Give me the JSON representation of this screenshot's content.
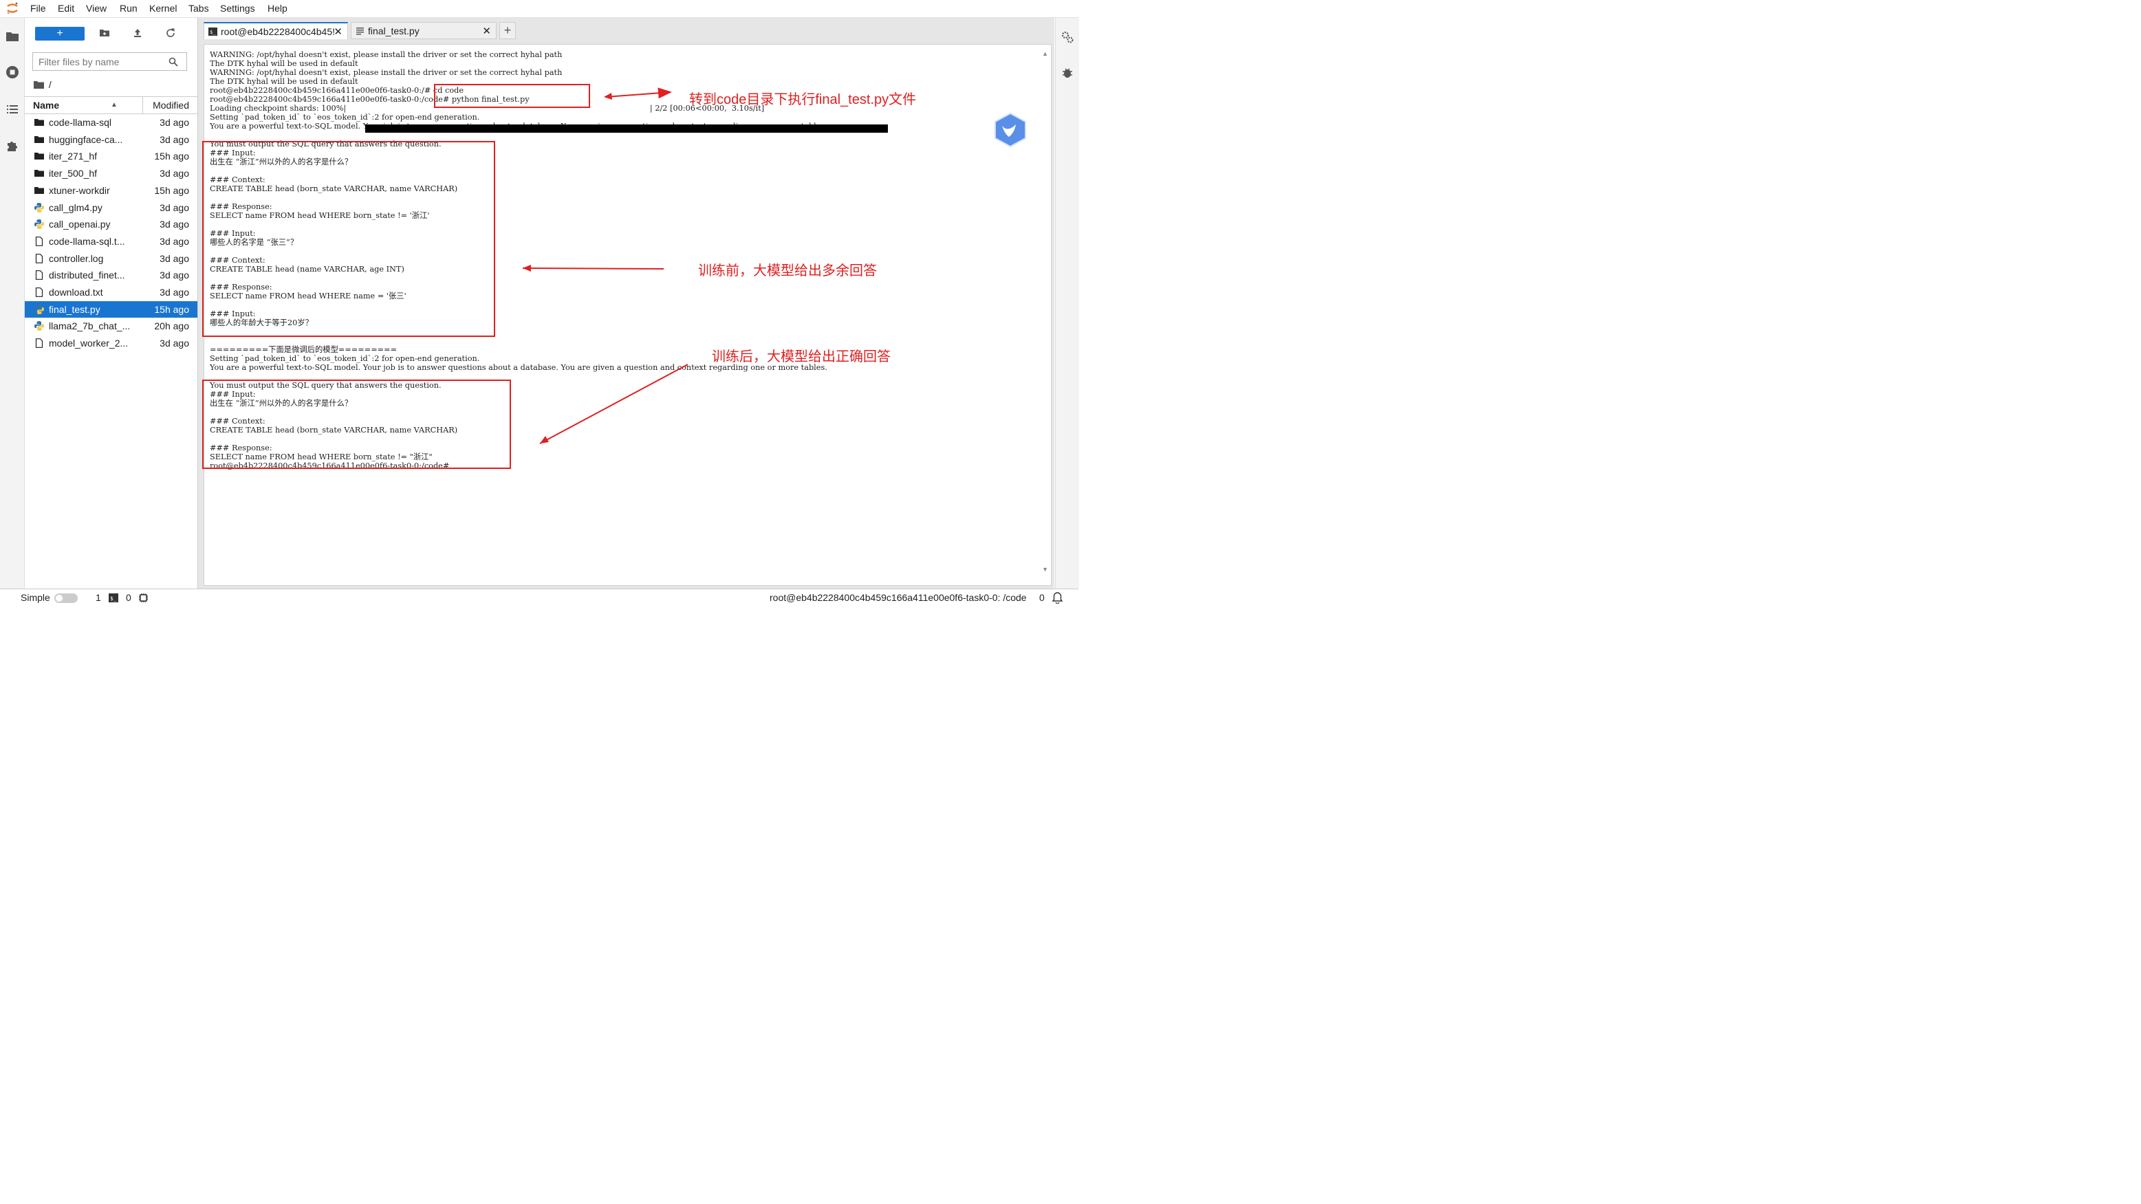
{
  "menu": [
    "File",
    "Edit",
    "View",
    "Run",
    "Kernel",
    "Tabs",
    "Settings",
    "Help"
  ],
  "file_browser": {
    "new_label": "+",
    "filter_placeholder": "Filter files by name",
    "breadcrumb": "/",
    "col_name": "Name",
    "col_modified": "Modified",
    "files": [
      {
        "name": "code-llama-sql",
        "modified": "3d ago",
        "type": "folder"
      },
      {
        "name": "huggingface-ca...",
        "modified": "3d ago",
        "type": "folder"
      },
      {
        "name": "iter_271_hf",
        "modified": "15h ago",
        "type": "folder"
      },
      {
        "name": "iter_500_hf",
        "modified": "3d ago",
        "type": "folder"
      },
      {
        "name": "xtuner-workdir",
        "modified": "15h ago",
        "type": "folder"
      },
      {
        "name": "call_glm4.py",
        "modified": "3d ago",
        "type": "python"
      },
      {
        "name": "call_openai.py",
        "modified": "3d ago",
        "type": "python"
      },
      {
        "name": "code-llama-sql.t...",
        "modified": "3d ago",
        "type": "file"
      },
      {
        "name": "controller.log",
        "modified": "3d ago",
        "type": "file"
      },
      {
        "name": "distributed_finet...",
        "modified": "3d ago",
        "type": "file"
      },
      {
        "name": "download.txt",
        "modified": "3d ago",
        "type": "file"
      },
      {
        "name": "final_test.py",
        "modified": "15h ago",
        "type": "python",
        "selected": true
      },
      {
        "name": "llama2_7b_chat_...",
        "modified": "20h ago",
        "type": "python"
      },
      {
        "name": "model_worker_2...",
        "modified": "3d ago",
        "type": "file"
      }
    ]
  },
  "tabs": [
    {
      "label": "root@eb4b2228400c4b45!",
      "active": true,
      "icon": "terminal-icon"
    },
    {
      "label": "final_test.py",
      "active": false,
      "icon": "text-file-icon"
    }
  ],
  "add_tab_label": "+",
  "terminal_text": "WARNING: /opt/hyhal doesn't exist, please install the driver or set the correct hyhal path\nThe DTK hyhal will be used in default\nWARNING: /opt/hyhal doesn't exist, please install the driver or set the correct hyhal path\nThe DTK hyhal will be used in default\nroot@eb4b2228400c4b459c166a411e00e0f6-task0-0:/# cd code\nroot@eb4b2228400c4b459c166a411e00e0f6-task0-0:/code# python final_test.py\nLoading checkpoint shards: 100%|                                                                                                                           | 2/2 [00:06<00:00,  3.10s/it]\nSetting `pad_token_id` to `eos_token_id`:2 for open-end generation.\nYou are a powerful text-to-SQL model. Your job is to answer questions about a database. You are given a question and context regarding one or more tables.\n\nYou must output the SQL query that answers the question.\n### Input:\n出生在 “浙江”州以外的人的名字是什么？\n\n### Context:\nCREATE TABLE head (born_state VARCHAR, name VARCHAR)\n\n### Response:\nSELECT name FROM head WHERE born_state != '浙江'\n\n### Input:\n哪些人的名字是 “张三”？\n\n### Context:\nCREATE TABLE head (name VARCHAR, age INT)\n\n### Response:\nSELECT name FROM head WHERE name = '张三'\n\n### Input:\n哪些人的年龄大于等于20岁？\n\n\n=========下面是微调后的模型=========\nSetting `pad_token_id` to `eos_token_id`:2 for open-end generation.\nYou are a powerful text-to-SQL model. Your job is to answer questions about a database. You are given a question and context regarding one or more tables.\n\nYou must output the SQL query that answers the question.\n### Input:\n出生在 “浙江”州以外的人的名字是什么？\n\n### Context:\nCREATE TABLE head (born_state VARCHAR, name VARCHAR)\n\n### Response:\nSELECT name FROM head WHERE born_state != \"浙江\"\nroot@eb4b2228400c4b459c166a411e00e0f6-task0-0:/code#",
  "annotations": {
    "a1": "转到code目录下执行final_test.py文件",
    "a2": "训练前，大模型给出多余回答",
    "a3": "训练后，大模型给出正确回答"
  },
  "status": {
    "mode_label": "Simple",
    "terminals_count": "1",
    "kernels_count": "0",
    "right_text": "root@eb4b2228400c4b459c166a411e00e0f6-task0-0: /code",
    "right_count": "0"
  },
  "colors": {
    "accent": "#1a75d1",
    "annotation": "#e02020"
  }
}
